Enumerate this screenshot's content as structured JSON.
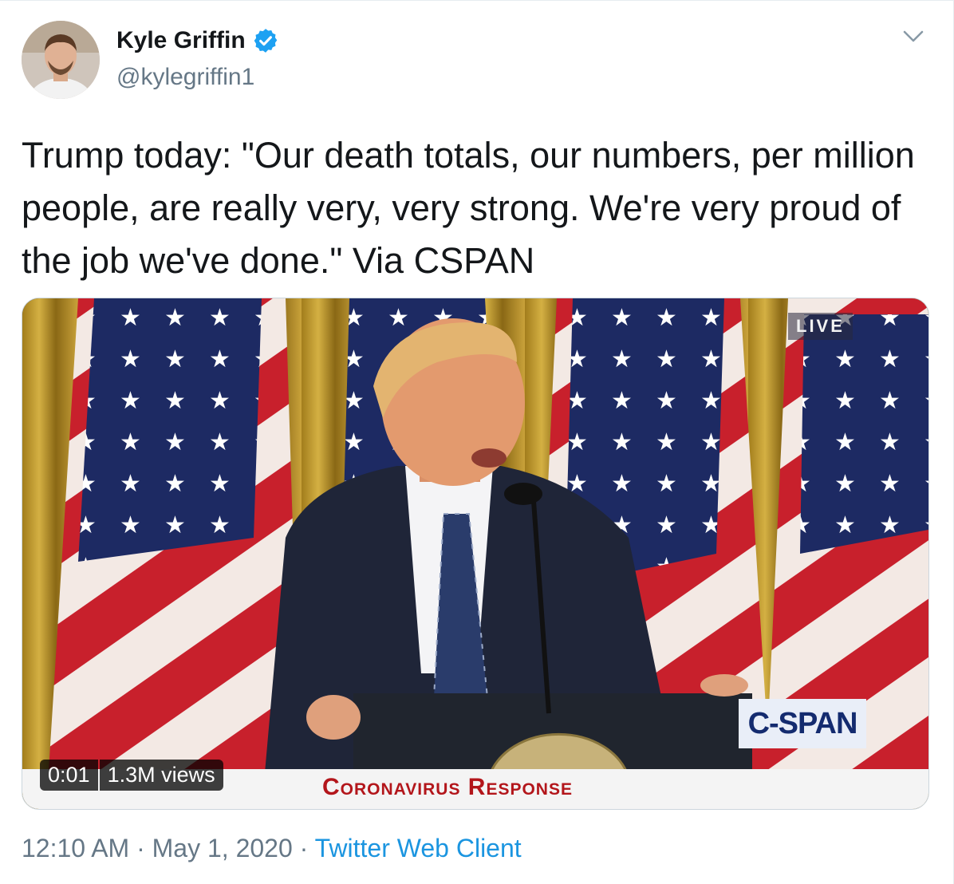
{
  "user": {
    "name": "Kyle Griffin",
    "handle": "@kylegriffin1",
    "verified_icon": "verified-badge-icon",
    "avatar": "avatar"
  },
  "tweet": {
    "text": "Trump today: \"Our death totals, our numbers, per million people, are really very, very strong. We're very proud of the job we've done.\" Via CSPAN"
  },
  "video": {
    "live_label": "LIVE",
    "network_logo": "C-SPAN",
    "banner": "Coronavirus Response",
    "time": "0:01",
    "views": "1.3M views"
  },
  "meta": {
    "time": "12:10 AM",
    "separator1": " · ",
    "date": "May 1, 2020",
    "separator2": " · ",
    "client": "Twitter Web Client"
  },
  "colors": {
    "link": "#1b95e0",
    "secondary_text": "#657786",
    "verified": "#1da1f2"
  }
}
